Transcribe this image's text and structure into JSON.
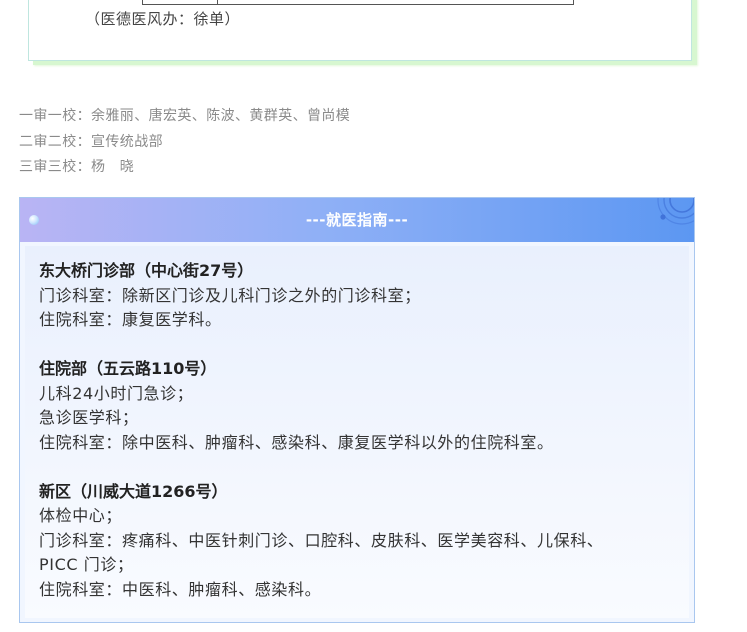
{
  "credit": {
    "note": "（医德医风办：徐单）"
  },
  "reviews": [
    {
      "text": "一审一校：余雅丽、唐宏英、陈波、黄群英、曾尚模"
    },
    {
      "text": "二审二校：宣传统战部"
    },
    {
      "text": "三审三校：杨　晓"
    }
  ],
  "guide": {
    "title": "---就医指南---",
    "sections": [
      {
        "title": "东大桥门诊部（中心街27号）",
        "lines": [
          "门诊科室：除新区门诊及儿科门诊之外的门诊科室；",
          "住院科室：康复医学科。"
        ]
      },
      {
        "title": "住院部（五云路110号）",
        "lines": [
          "儿科24小时门急诊；",
          "急诊医学科；",
          "住院科室：除中医科、肿瘤科、感染科、康复医学科以外的住院科室。"
        ]
      },
      {
        "title": "新区（川威大道1266号）",
        "lines": [
          "体检中心；",
          "门诊科室：疼痛科、中医针刺门诊、口腔科、皮肤科、医学美容科、儿保科、",
          "PICC 门诊；",
          "住院科室：中医科、肿瘤科、感染科。"
        ]
      }
    ]
  }
}
